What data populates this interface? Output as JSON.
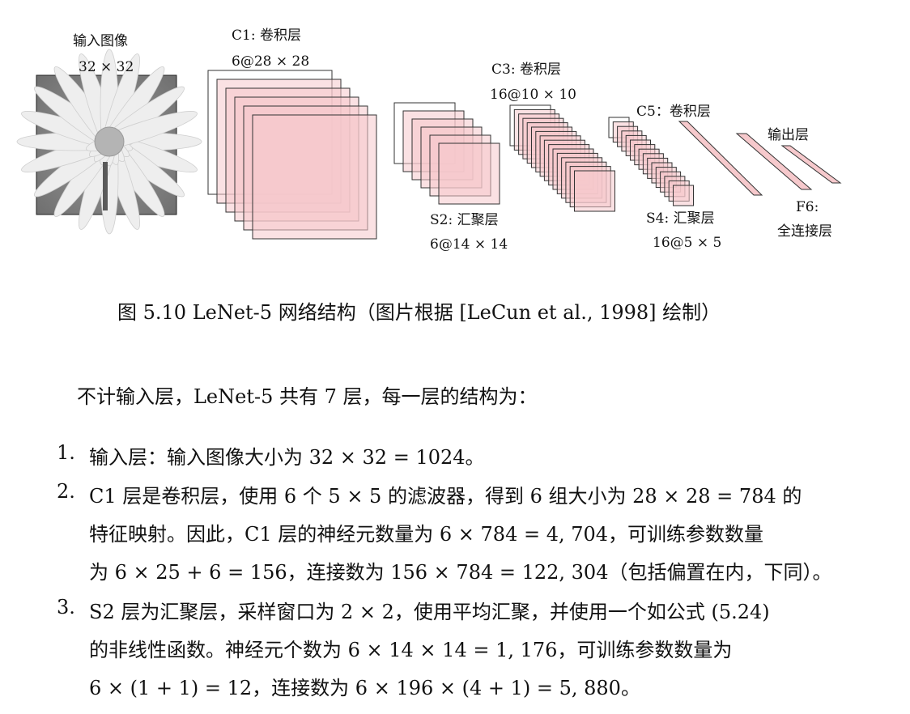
{
  "figure": {
    "input_label": "输入图像",
    "input_size": "32 × 32",
    "c1_label": "C1: 卷积层",
    "c1_size": "6@28 × 28",
    "s2_label": "S2: 汇聚层",
    "s2_size": "6@14 × 14",
    "c3_label": "C3: 卷积层",
    "c3_size": "16@10 × 10",
    "s4_label": "S4: 汇聚层",
    "s4_size": "16@5 × 5",
    "c5_label": "C5：卷积层",
    "output_label": "输出层",
    "f6_label": "F6:",
    "f6_desc": "全连接层",
    "map_color": "#f6c9cc",
    "map_stroke": "#333333"
  },
  "caption": "图 5.10 LeNet-5 网络结构（图片根据 [LeCun et al., 1998] 绘制）",
  "intro": "不计输入层，LeNet-5 共有 7 层，每一层的结构为：",
  "list": [
    {
      "num": "1.",
      "lines": [
        "输入层：输入图像大小为 32 × 32 = 1024。"
      ]
    },
    {
      "num": "2.",
      "lines": [
        "C1 层是卷积层，使用 6 个 5 × 5 的滤波器，得到 6 组大小为 28 × 28 = 784 的",
        "特征映射。因此，C1 层的神经元数量为 6 × 784 = 4, 704，可训练参数数量",
        "为 6 × 25 + 6 = 156，连接数为 156 × 784 = 122, 304（包括偏置在内，下同）。"
      ]
    },
    {
      "num": "3.",
      "lines": [
        "S2 层为汇聚层，采样窗口为 2 × 2，使用平均汇聚，并使用一个如公式 (5.24)",
        "的非线性函数。神经元个数为 6 × 14 × 14 = 1, 176，可训练参数数量为",
        "6 × (1 + 1) = 12，连接数为 6 × 196 × (4 + 1) = 5, 880。"
      ]
    }
  ]
}
